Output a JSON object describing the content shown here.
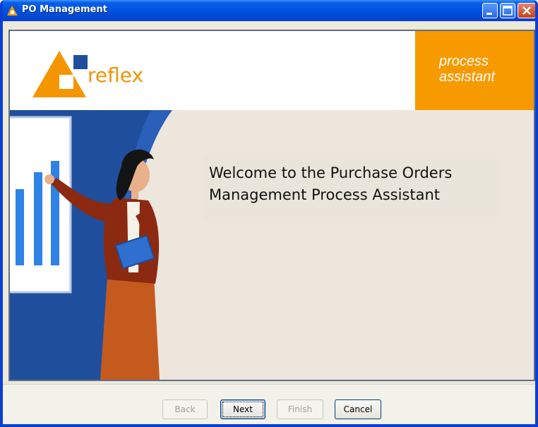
{
  "window": {
    "title": "PO Management",
    "controls": {
      "minimize_icon": "minimize-icon",
      "maximize_icon": "maximize-icon",
      "close_icon": "close-icon"
    }
  },
  "header": {
    "logo_text": "reflex",
    "badge_line1": "process",
    "badge_line2": "assistant"
  },
  "hero": {
    "welcome_line1": "Welcome to the Purchase Orders",
    "welcome_line2": "Management Process Assistant"
  },
  "buttons": {
    "back": "Back",
    "next": "Next",
    "finish": "Finish",
    "cancel": "Cancel"
  },
  "colors": {
    "accent": "#f79a00",
    "titlebar": "#0054e3",
    "navy": "#1f4f9c"
  }
}
